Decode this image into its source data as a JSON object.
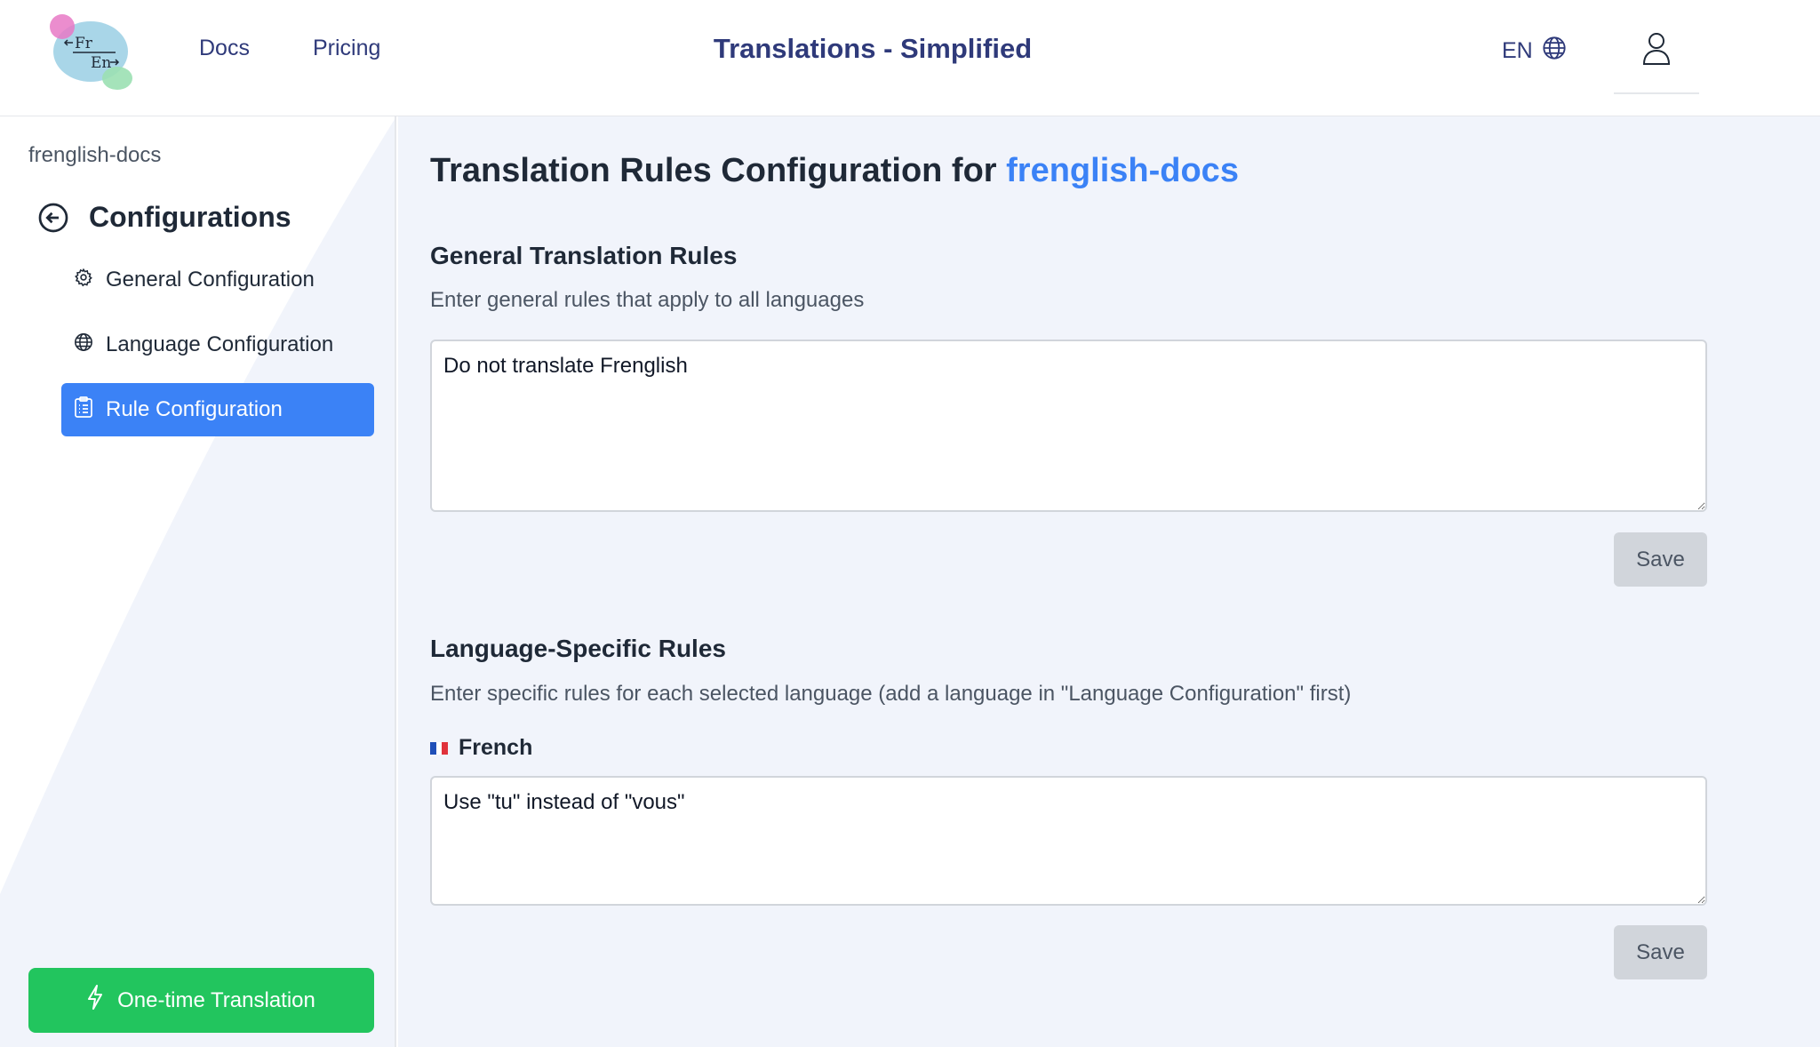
{
  "header": {
    "logo": {
      "top_text": "Fr",
      "bottom_text": "En"
    },
    "nav": {
      "docs": "Docs",
      "pricing": "Pricing"
    },
    "title": "Translations - Simplified",
    "language": "EN"
  },
  "sidebar": {
    "project_name": "frenglish-docs",
    "title": "Configurations",
    "items": [
      {
        "label": "General Configuration",
        "icon": "gear-icon",
        "active": false
      },
      {
        "label": "Language Configuration",
        "icon": "globe-icon",
        "active": false
      },
      {
        "label": "Rule Configuration",
        "icon": "clipboard-list-icon",
        "active": true
      }
    ],
    "onetime_button": "One-time Translation"
  },
  "main": {
    "title_prefix": "Translation Rules Configuration for",
    "title_project": "frenglish-docs",
    "general": {
      "heading": "General Translation Rules",
      "description": "Enter general rules that apply to all languages",
      "value": "Do not translate Frenglish",
      "save_label": "Save"
    },
    "specific": {
      "heading": "Language-Specific Rules",
      "description": "Enter specific rules for each selected language (add a language in \"Language Configuration\" first)",
      "languages": [
        {
          "flag": "🇫🇷",
          "name": "French",
          "value": "Use \"tu\" instead of \"vous\"",
          "save_label": "Save"
        }
      ]
    }
  },
  "colors": {
    "brand_navy": "#2f3a7a",
    "accent_blue": "#3b82f6",
    "success_green": "#22c55e",
    "main_background": "#f1f4fb",
    "disabled_button": "#d1d5db"
  }
}
